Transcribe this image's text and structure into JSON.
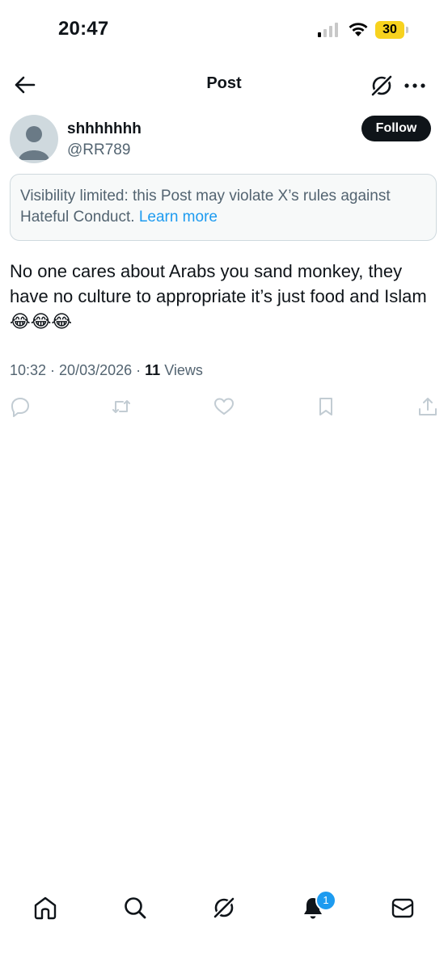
{
  "status_bar": {
    "time": "20:47",
    "battery": "30"
  },
  "header": {
    "title": "Post"
  },
  "author": {
    "display_name": "shhhhhhh",
    "handle": "@RR789",
    "follow_label": "Follow"
  },
  "notice": {
    "text": "Visibility limited: this Post may violate X’s rules against Hateful Conduct.",
    "link": "Learn more"
  },
  "post": {
    "text": "No one cares about Arabs you sand monkey, they have no culture to appropriate it’s just food and Islam",
    "emojis": "😂😂😂",
    "time": "10:32",
    "date": "20/03/2026",
    "views_count": "11",
    "views_label": "Views"
  },
  "actions": [
    "reply-icon",
    "repost-icon",
    "like-icon",
    "bookmark-icon",
    "share-icon"
  ],
  "bottom_nav": {
    "items": [
      "home-icon",
      "search-icon",
      "grok-icon",
      "notifications-icon",
      "messages-icon"
    ],
    "notification_badge": "1"
  },
  "colors": {
    "text_primary": "#0f1419",
    "text_secondary": "#536471",
    "link": "#1d9bf0",
    "notice_bg": "#f7f9f9",
    "battery": "#f7d21e"
  }
}
